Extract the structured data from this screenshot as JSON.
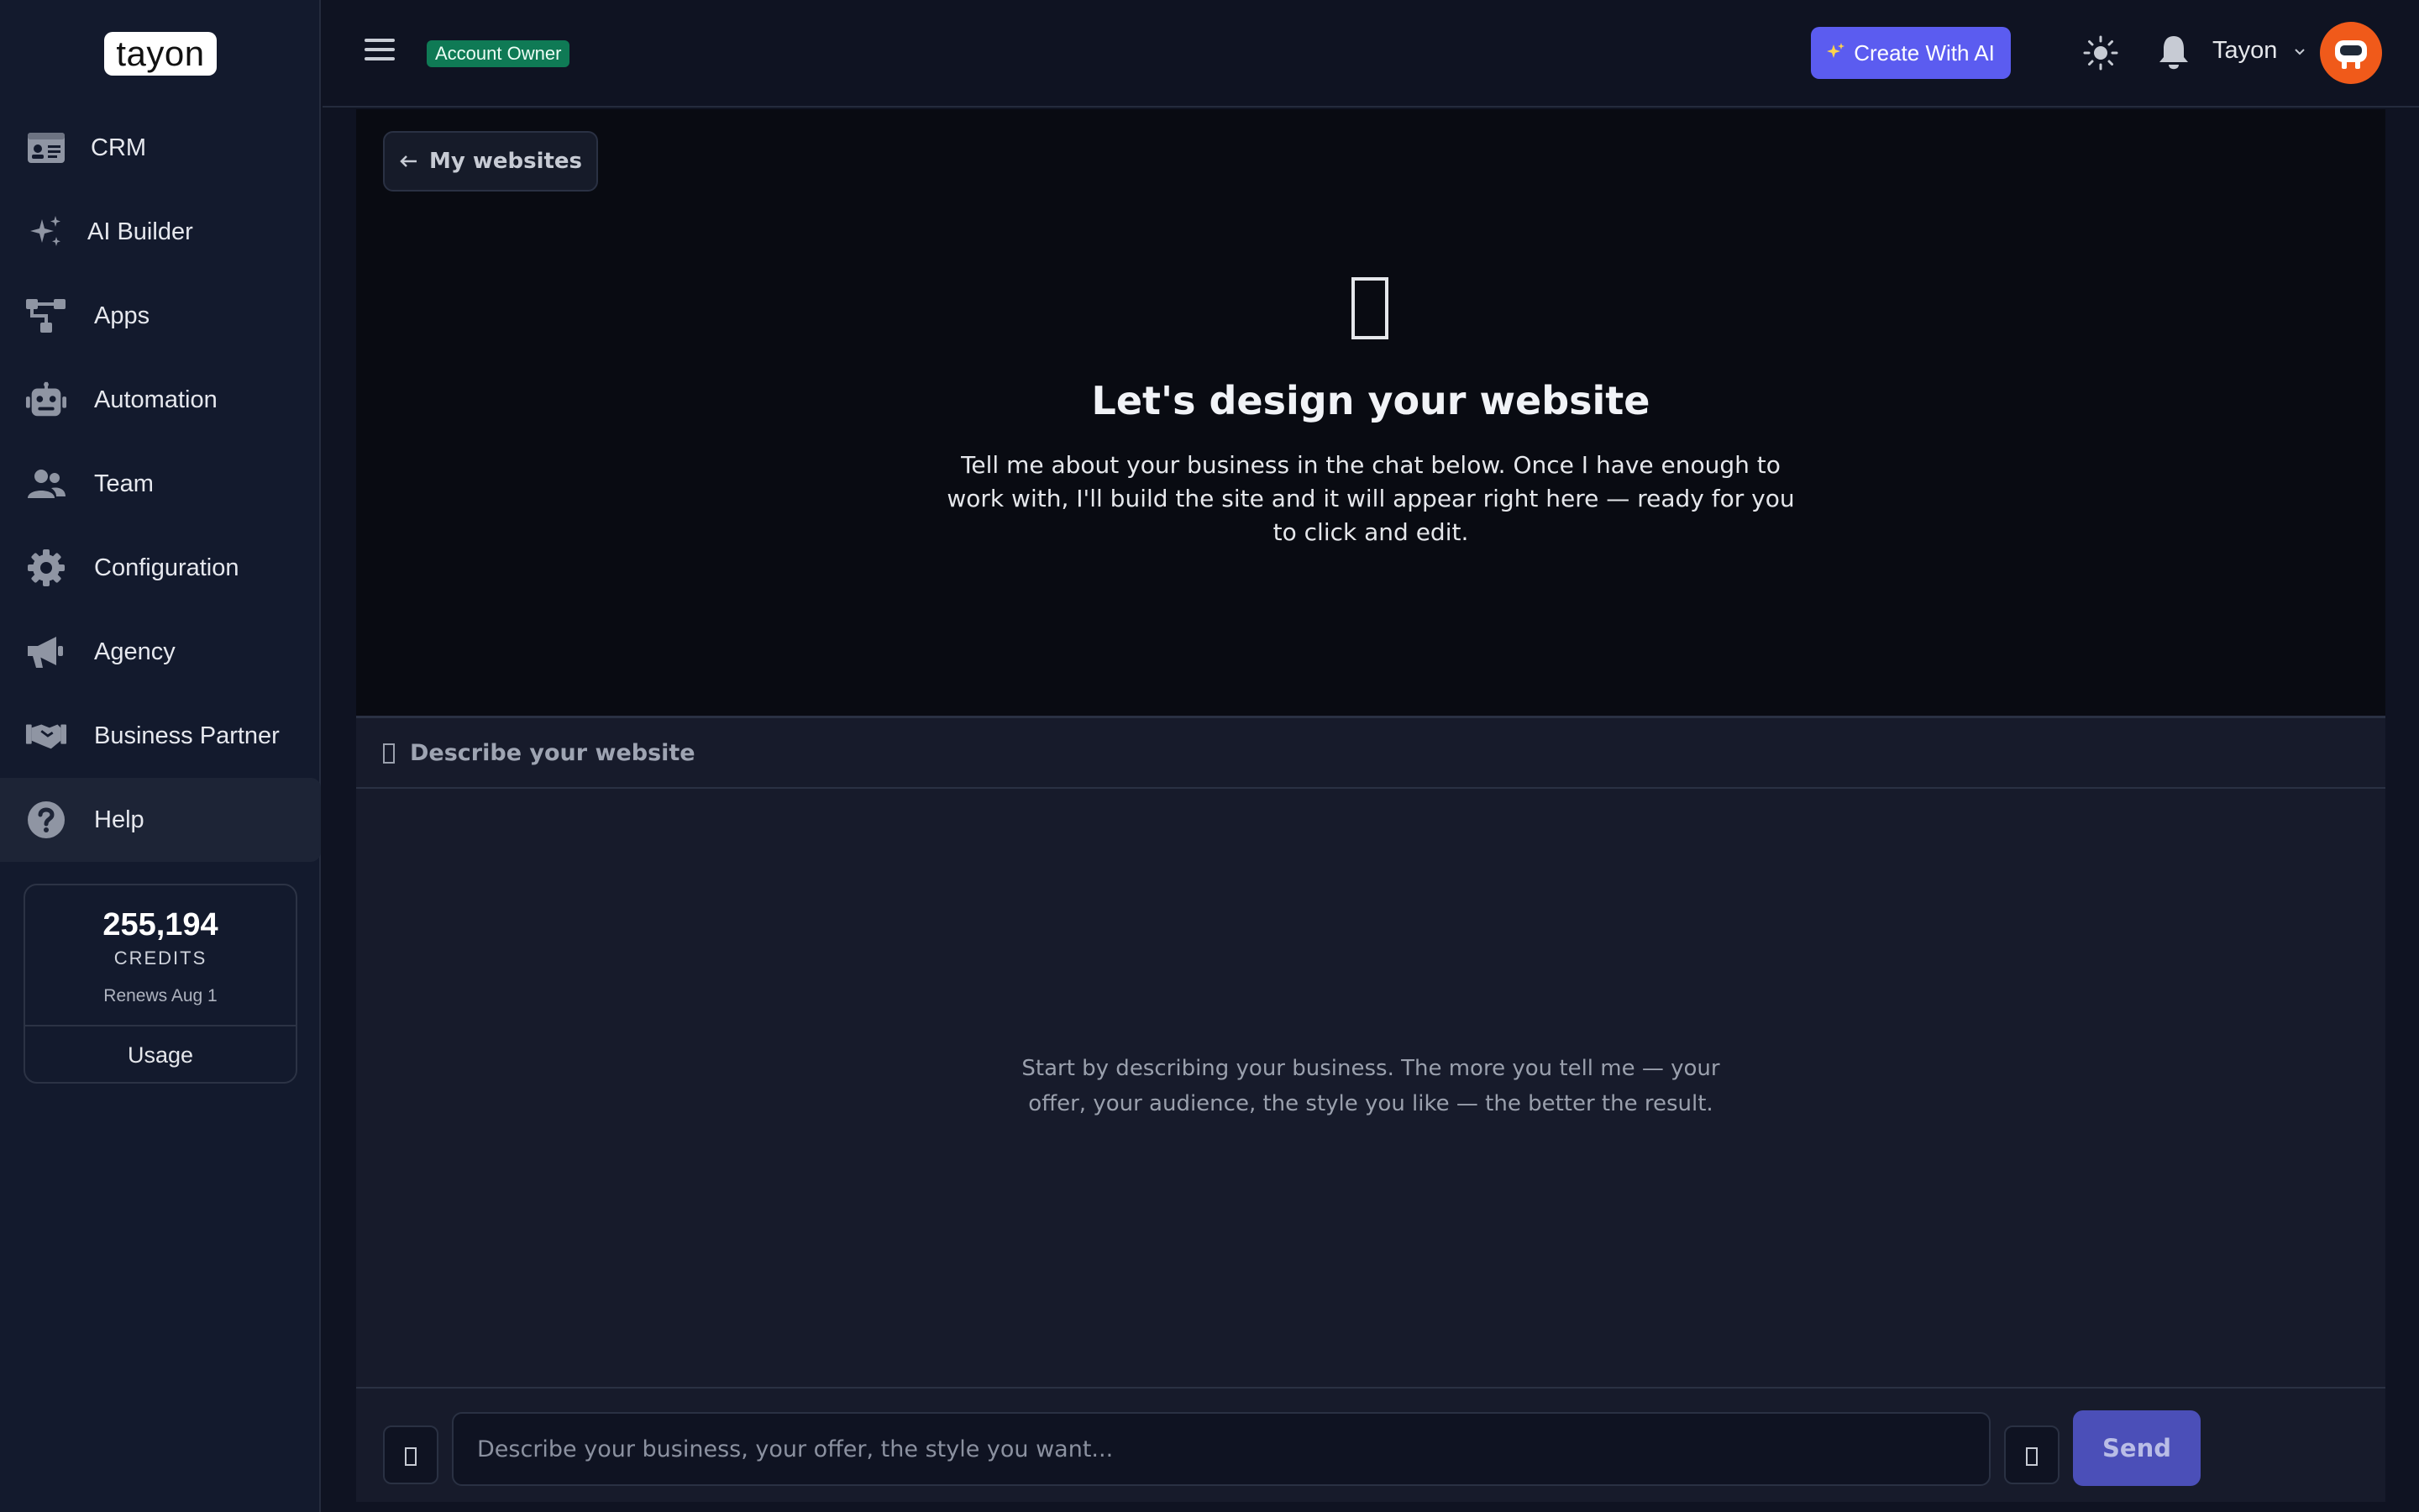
{
  "brand": {
    "logo_text": "tayon"
  },
  "sidebar": {
    "items": [
      {
        "label": "CRM",
        "icon": "id-card-icon"
      },
      {
        "label": "AI Builder",
        "icon": "sparkles-icon"
      },
      {
        "label": "Apps",
        "icon": "sitemap-icon"
      },
      {
        "label": "Automation",
        "icon": "robot-icon"
      },
      {
        "label": "Team",
        "icon": "users-icon"
      },
      {
        "label": "Configuration",
        "icon": "gear-icon"
      },
      {
        "label": "Agency",
        "icon": "megaphone-icon"
      },
      {
        "label": "Business Partner",
        "icon": "handshake-icon"
      },
      {
        "label": "Help",
        "icon": "question-circle-icon"
      }
    ],
    "active_item": "Help"
  },
  "credits": {
    "amount": "255,194",
    "unit": "CREDITS",
    "renews": "Renews Aug 1",
    "usage_label": "Usage"
  },
  "header": {
    "role_badge": "Account Owner",
    "create_ai_label": "Create With AI",
    "user_name": "Tayon"
  },
  "preview": {
    "back_label": "My websites",
    "title": "Let's design your website",
    "description": "Tell me about your business in the chat below. Once I have enough to work with, I'll build the site and it will appear right here — ready for you to click and edit."
  },
  "chat": {
    "header_label": "Describe your website",
    "empty_text": "Start by describing your business. The more you tell me — your offer, your audience, the style you like — the better the result.",
    "input_placeholder": "Describe your business, your offer, the style you want...",
    "send_label": "Send"
  },
  "colors": {
    "sidebar_bg": "#131a2d",
    "page_bg": "#0f1322",
    "preview_bg": "#090b12",
    "accent": "#5b5cf0",
    "badge_green": "#0f7a55",
    "avatar_orange": "#f05a1a",
    "send_bg": "#4b4fb8"
  }
}
